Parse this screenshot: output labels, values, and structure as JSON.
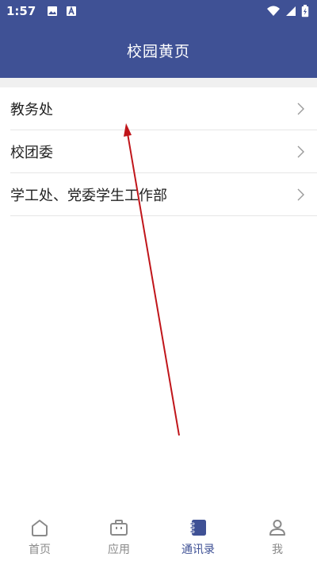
{
  "status_bar": {
    "time": "1:57",
    "left_icons": [
      "image-icon",
      "font-icon"
    ],
    "right_icons": [
      "wifi-icon",
      "signal-icon",
      "battery-icon"
    ]
  },
  "header": {
    "title": "校园黄页"
  },
  "list": {
    "items": [
      {
        "label": "教务处"
      },
      {
        "label": "校团委"
      },
      {
        "label": "学工处、党委学生工作部"
      }
    ]
  },
  "tabbar": {
    "tabs": [
      {
        "label": "首页",
        "icon": "home-icon",
        "active": false
      },
      {
        "label": "应用",
        "icon": "briefcase-icon",
        "active": false
      },
      {
        "label": "通讯录",
        "icon": "contacts-book-icon",
        "active": true
      },
      {
        "label": "我",
        "icon": "person-icon",
        "active": false
      }
    ]
  },
  "colors": {
    "primary": "#3f5195",
    "inactive": "#8a8a8a",
    "arrow": "#c0151a"
  }
}
